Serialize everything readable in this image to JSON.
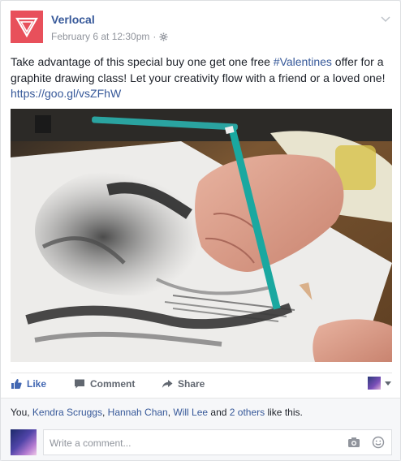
{
  "post": {
    "author": "Verlocal",
    "timestamp": "February 6 at 12:30pm",
    "separator": "·",
    "text_before": "Take advantage of this special buy one get one free ",
    "hashtag": "#Valentines",
    "text_after": " offer for a graphite drawing class! Let your creativity flow with a friend or a loved one! ",
    "url": "https://goo.gl/vsZFhW"
  },
  "actions": {
    "like": "Like",
    "comment": "Comment",
    "share": "Share"
  },
  "likes": {
    "you": "You, ",
    "name1": "Kendra Scruggs",
    "sep1": ", ",
    "name2": "Hannah Chan",
    "sep2": ", ",
    "name3": "Will Lee",
    "and": " and ",
    "others": "2 others",
    "suffix": " like this."
  },
  "comment_box": {
    "placeholder": "Write a comment..."
  },
  "colors": {
    "brand": "#e8505b",
    "link": "#365899",
    "like_blue": "#4267b2"
  }
}
